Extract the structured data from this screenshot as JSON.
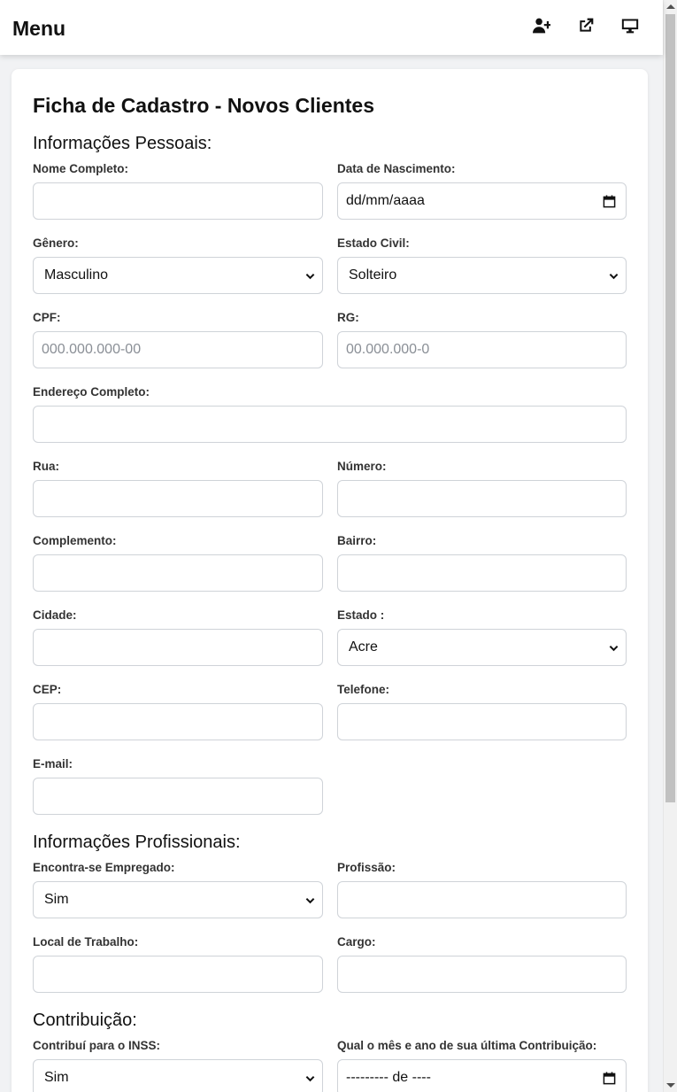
{
  "header": {
    "title": "Menu",
    "icons": [
      "user-plus-icon",
      "external-link-icon",
      "desktop-icon"
    ]
  },
  "form": {
    "title": "Ficha de Cadastro - Novos Clientes",
    "personal": {
      "heading": "Informações Pessoais:",
      "nome_label": "Nome Completo:",
      "nome_value": "",
      "nascimento_label": "Data de Nascimento:",
      "nascimento_value": "dd/mm/aaaa",
      "genero_label": "Gênero:",
      "genero_value": "Masculino",
      "estado_civil_label": "Estado Civil:",
      "estado_civil_value": "Solteiro",
      "cpf_label": "CPF:",
      "cpf_placeholder": "000.000.000-00",
      "rg_label": "RG:",
      "rg_placeholder": "00.000.000-0",
      "endereco_label": "Endereço Completo:",
      "rua_label": "Rua:",
      "numero_label": "Número:",
      "complemento_label": "Complemento:",
      "bairro_label": "Bairro:",
      "cidade_label": "Cidade:",
      "estado_label": "Estado :",
      "estado_value": "Acre",
      "cep_label": "CEP:",
      "telefone_label": "Telefone:",
      "email_label": "E-mail:"
    },
    "professional": {
      "heading": "Informações Profissionais:",
      "empregado_label": "Encontra-se Empregado:",
      "empregado_value": "Sim",
      "profissao_label": "Profissão:",
      "local_label": "Local de Trabalho:",
      "cargo_label": "Cargo:"
    },
    "contribution": {
      "heading": "Contribuição:",
      "inss_label": "Contribuí para o INSS:",
      "inss_value": "Sim",
      "ultima_label": "Qual o mês e ano de sua última Contribuição:",
      "ultima_value": "--------- de ----"
    }
  },
  "colors": {
    "page_background": "#f1f2f4",
    "card_background": "#ffffff",
    "input_border": "#cfd3d8",
    "placeholder": "#8a8f96"
  }
}
